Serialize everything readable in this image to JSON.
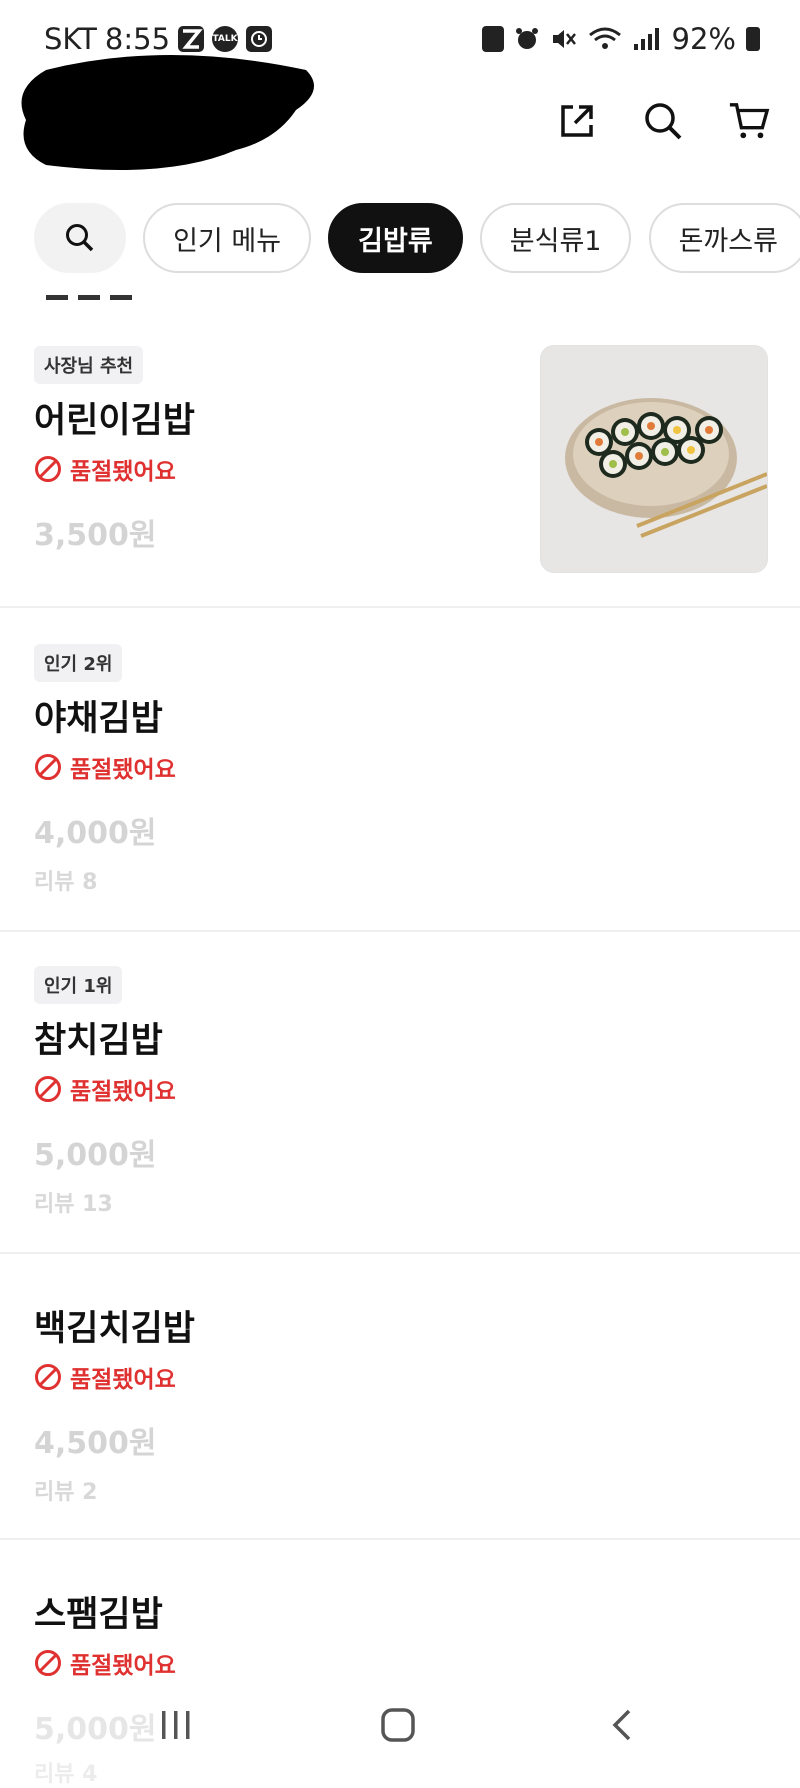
{
  "status_bar": {
    "carrier": "SKT",
    "time": "8:55",
    "icons_left": [
      "z-icon",
      "talk-icon",
      "clock-app-icon"
    ],
    "icons_right": [
      "recycle-icon",
      "alarm-icon",
      "mute-icon",
      "wifi-icon",
      "signal-icon"
    ],
    "battery": "92%",
    "talk_text": "TALK"
  },
  "header": {
    "icons": [
      "share-icon",
      "search-icon",
      "cart-icon"
    ]
  },
  "categories": {
    "search_icon": "search-icon",
    "chips": [
      "인기 메뉴",
      "김밥류",
      "분식류1",
      "돈까스류"
    ],
    "active_index": 1
  },
  "menu_items": [
    {
      "badge": "사장님 추천",
      "name": "어린이김밥",
      "soldout": "품절됐어요",
      "price": "3,500원",
      "review": "",
      "has_image": true
    },
    {
      "badge": "인기 2위",
      "name": "야채김밥",
      "soldout": "품절됐어요",
      "price": "4,000원",
      "review": "리뷰 8",
      "has_image": false
    },
    {
      "badge": "인기 1위",
      "name": "참치김밥",
      "soldout": "품절됐어요",
      "price": "5,000원",
      "review": "리뷰 13",
      "has_image": false
    },
    {
      "badge": "",
      "name": "백김치김밥",
      "soldout": "품절됐어요",
      "price": "4,500원",
      "review": "리뷰 2",
      "has_image": false
    },
    {
      "badge": "",
      "name": "스팸김밥",
      "soldout": "품절됐어요",
      "price": "5,000원",
      "review": "리뷰 4",
      "has_image": false
    }
  ],
  "colors": {
    "soldout": "#e03131",
    "active_chip": "#111111",
    "price_disabled": "#d4d4d4"
  },
  "nav": {
    "icons": [
      "recent-apps-icon",
      "home-icon",
      "back-icon"
    ]
  }
}
